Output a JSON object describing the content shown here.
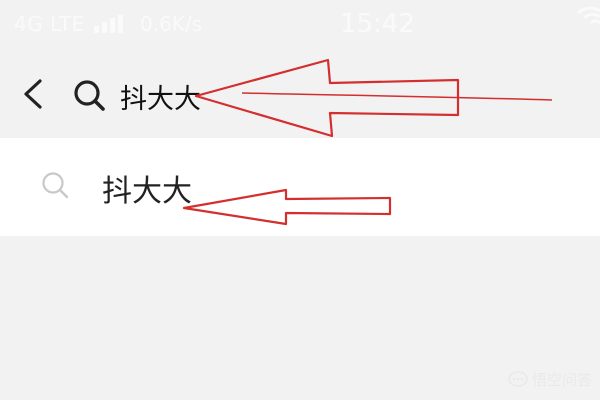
{
  "status_bar": {
    "network": "4G LTE",
    "speed": "0.6K/s",
    "time": "15:42"
  },
  "search": {
    "query": "抖大大"
  },
  "suggestions": [
    {
      "label": "抖大大"
    }
  ],
  "watermark": {
    "text": "悟空问答"
  },
  "colors": {
    "annotation_arrow": "#d32f2f",
    "background": "#f2f2f2",
    "panel": "#ffffff"
  }
}
